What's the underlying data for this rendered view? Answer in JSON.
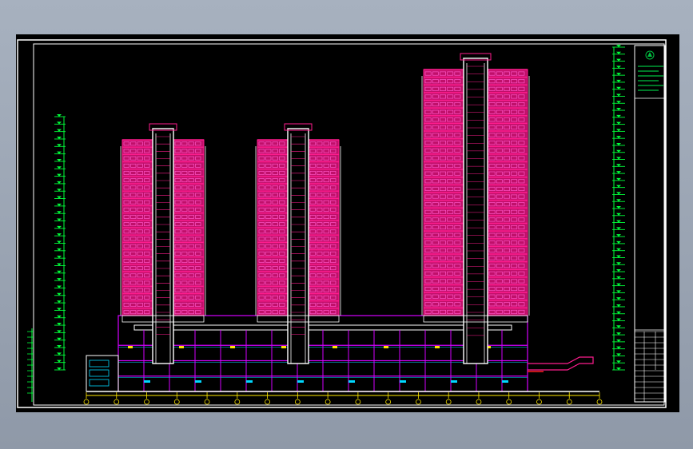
{
  "drawing": {
    "background": "#000000",
    "frame_color": "#ffffff",
    "colors": {
      "facade": "#ff1c8e",
      "facade_dark": "#c0106a",
      "window": "#ff55c8",
      "frame_white": "#ffffff",
      "podium_magenta": "#d400ff",
      "podium_cyan": "#00d8ff",
      "podium_yellow": "#ffe000",
      "level_green": "#00ff3a",
      "ground_yellow": "#ffe800",
      "title_green": "#00c040"
    },
    "towers": [
      {
        "name": "tower-left",
        "floors": 24
      },
      {
        "name": "tower-middle",
        "floors": 24
      },
      {
        "name": "tower-right",
        "floors": 32
      }
    ],
    "podium_floors": 4,
    "axis_count": 18,
    "title_block": {
      "logo_icon": "company-logo-icon",
      "note_lines": 6,
      "table_rows": 12
    }
  }
}
